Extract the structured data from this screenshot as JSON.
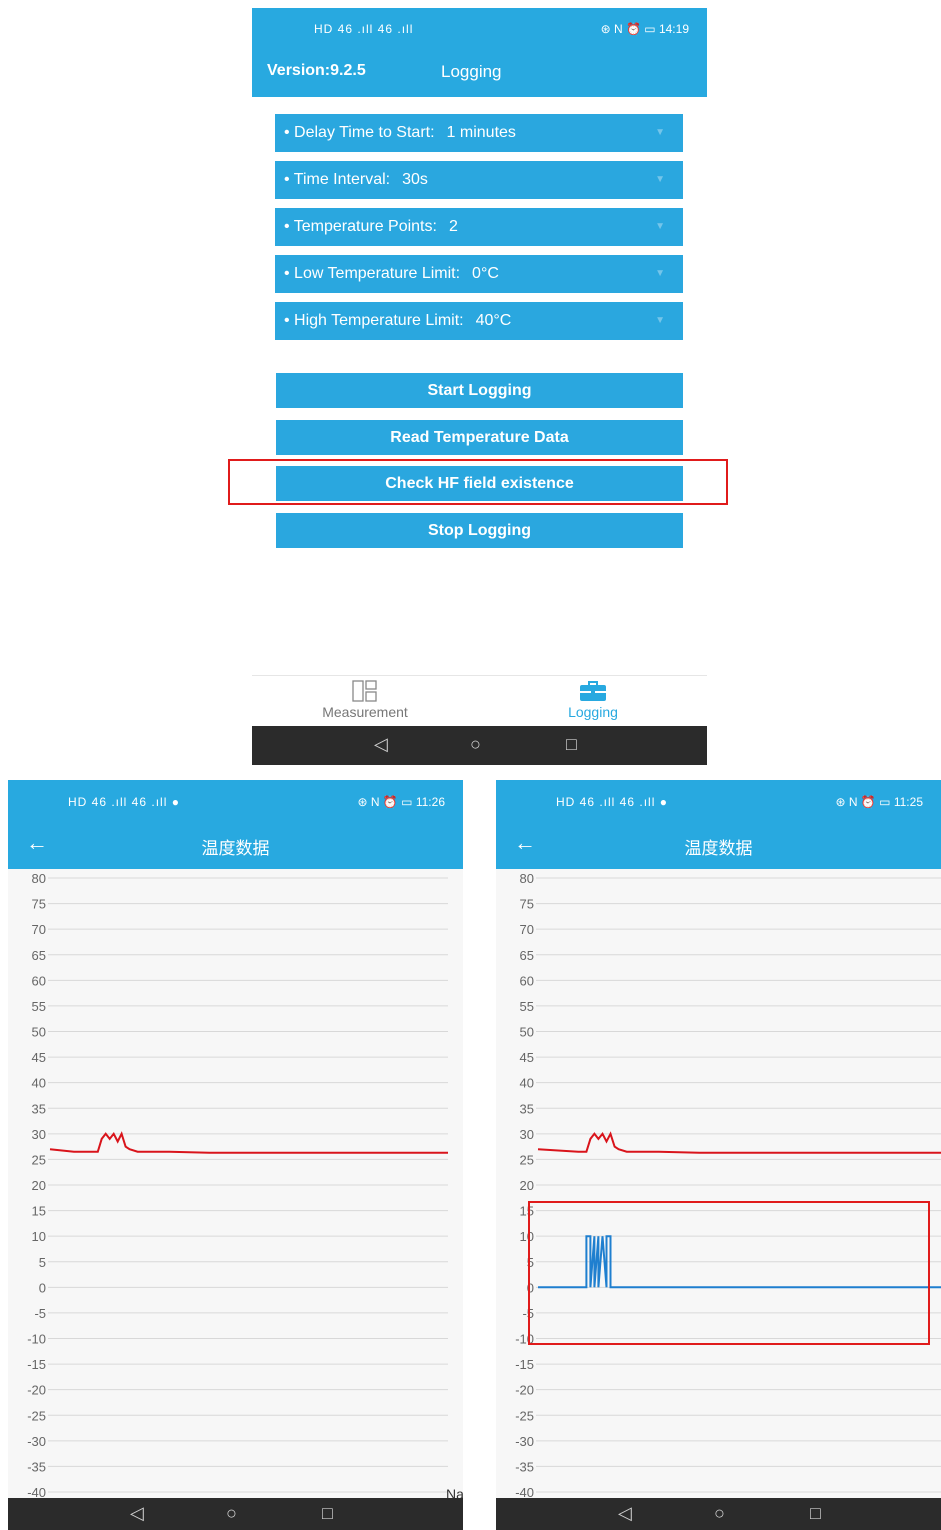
{
  "top_screen": {
    "status": {
      "left": "HD 46 .ıll 46 .ıll",
      "right": "⊛ N ⏰ ▭ 14:19"
    },
    "version": "Version:9.2.5",
    "title": "Logging",
    "settings": [
      {
        "key": "Delay Time to Start:",
        "value": "1 minutes"
      },
      {
        "key": "Time Interval:",
        "value": "30s"
      },
      {
        "key": "Temperature Points:",
        "value": "2"
      },
      {
        "key": "Low Temperature Limit:",
        "value": "0°C"
      },
      {
        "key": "High Temperature Limit:",
        "value": "40°C"
      }
    ],
    "buttons": {
      "start": "Start Logging",
      "read": "Read Temperature Data",
      "check": "Check HF field existence",
      "stop": "Stop Logging"
    },
    "nav": {
      "measurement": "Measurement",
      "logging": "Logging"
    },
    "colors": {
      "primary": "#28a9e0",
      "highlight": "#e01b1b"
    }
  },
  "left_screen": {
    "status": {
      "left": "HD 46 .ıll 46 .ıll ●",
      "right": "⊛ N ⏰ ▭ 11:26"
    },
    "title": "温度数据",
    "edge_text": "Na"
  },
  "right_screen": {
    "status": {
      "left": "HD 46 .ıll 46 .ıll ●",
      "right": "⊛ N ⏰ ▭ 11:25"
    },
    "title": "温度数据"
  },
  "chart_data": [
    {
      "type": "line",
      "title": "温度数据",
      "ylim": [
        -40,
        80
      ],
      "y_ticks": [
        80,
        75,
        70,
        65,
        60,
        55,
        50,
        45,
        40,
        35,
        30,
        25,
        20,
        15,
        10,
        5,
        0,
        -5,
        -10,
        -15,
        -20,
        -25,
        -30,
        -35,
        -40
      ],
      "series": [
        {
          "color": "#d9141b",
          "x": [
            0,
            6,
            12,
            13,
            14,
            15,
            16,
            17,
            18,
            19,
            20,
            22,
            25,
            30,
            40,
            60,
            100
          ],
          "y": [
            27,
            26.5,
            26.5,
            29,
            30,
            29,
            30,
            28.5,
            30,
            27.5,
            27,
            26.5,
            26.5,
            26.5,
            26.3,
            26.3,
            26.3
          ]
        }
      ]
    },
    {
      "type": "line",
      "title": "温度数据",
      "ylim": [
        -40,
        80
      ],
      "y_ticks": [
        80,
        75,
        70,
        65,
        60,
        55,
        50,
        45,
        40,
        35,
        30,
        25,
        20,
        15,
        10,
        5,
        0,
        -5,
        -10,
        -15,
        -20,
        -25,
        -30,
        -35,
        -40
      ],
      "series": [
        {
          "color": "#d9141b",
          "x": [
            0,
            10,
            12,
            13,
            14,
            15,
            16,
            17,
            18,
            19,
            20,
            22,
            25,
            30,
            40,
            60,
            100
          ],
          "y": [
            27,
            26.5,
            26.5,
            29,
            30,
            29,
            30,
            28.5,
            30,
            27.5,
            27,
            26.5,
            26.5,
            26.5,
            26.3,
            26.3,
            26.3
          ]
        },
        {
          "color": "#1f7fcf",
          "x": [
            0,
            12,
            12,
            13,
            13,
            14,
            14,
            15,
            15,
            16,
            16,
            17,
            17,
            18,
            18,
            100
          ],
          "y": [
            0,
            0,
            10,
            10,
            0,
            10,
            0,
            10,
            0,
            10,
            10,
            0,
            10,
            10,
            0,
            0
          ]
        }
      ]
    }
  ]
}
